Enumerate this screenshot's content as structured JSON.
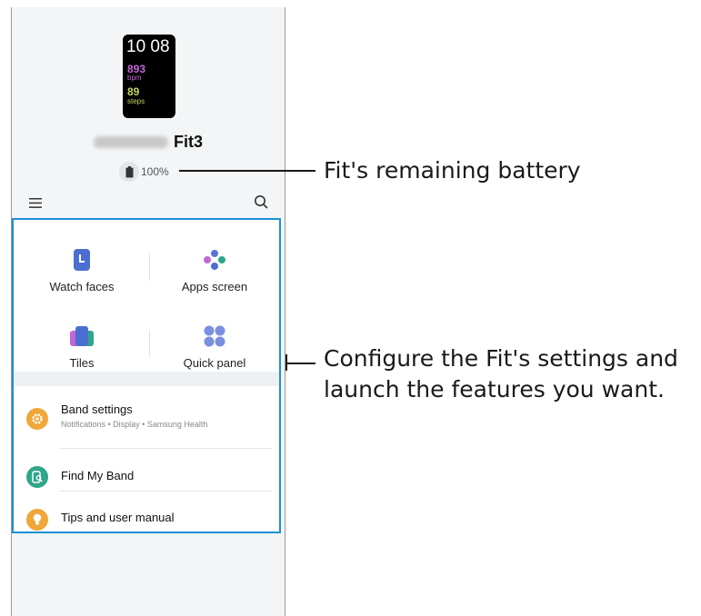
{
  "device": {
    "watch_time": "10 08",
    "heart_rate": "893",
    "heart_rate_unit": "bpm",
    "steps": "89",
    "steps_unit": "steps",
    "model": "Fit3",
    "battery": "100%"
  },
  "menu_icon": "hamburger-icon",
  "search_icon": "search-icon",
  "grid": [
    {
      "label": "Watch faces",
      "icon": "watch-faces-icon",
      "color": "#4a6fd1"
    },
    {
      "label": "Apps screen",
      "icon": "apps-screen-icon",
      "color": "#2fa58a"
    },
    {
      "label": "Tiles",
      "icon": "tiles-icon",
      "color": "#5e73d8"
    },
    {
      "label": "Quick panel",
      "icon": "quick-panel-icon",
      "color": "#7a8fe0"
    }
  ],
  "list": [
    {
      "title": "Band settings",
      "subtitle": "Notifications • Display • Samsung Health",
      "icon": "gear-icon",
      "color": "#f0a73a"
    },
    {
      "title": "Find My Band",
      "icon": "find-band-icon",
      "color": "#2fa58a"
    },
    {
      "title": "Tips and user manual",
      "icon": "bulb-icon",
      "color": "#f0a73a"
    }
  ],
  "callouts": {
    "battery": "Fit's remaining battery",
    "panel_line1": "Configure the Fit's settings and",
    "panel_line2": "launch the features you want."
  },
  "colors": {
    "highlight": "#1f8fd6"
  }
}
